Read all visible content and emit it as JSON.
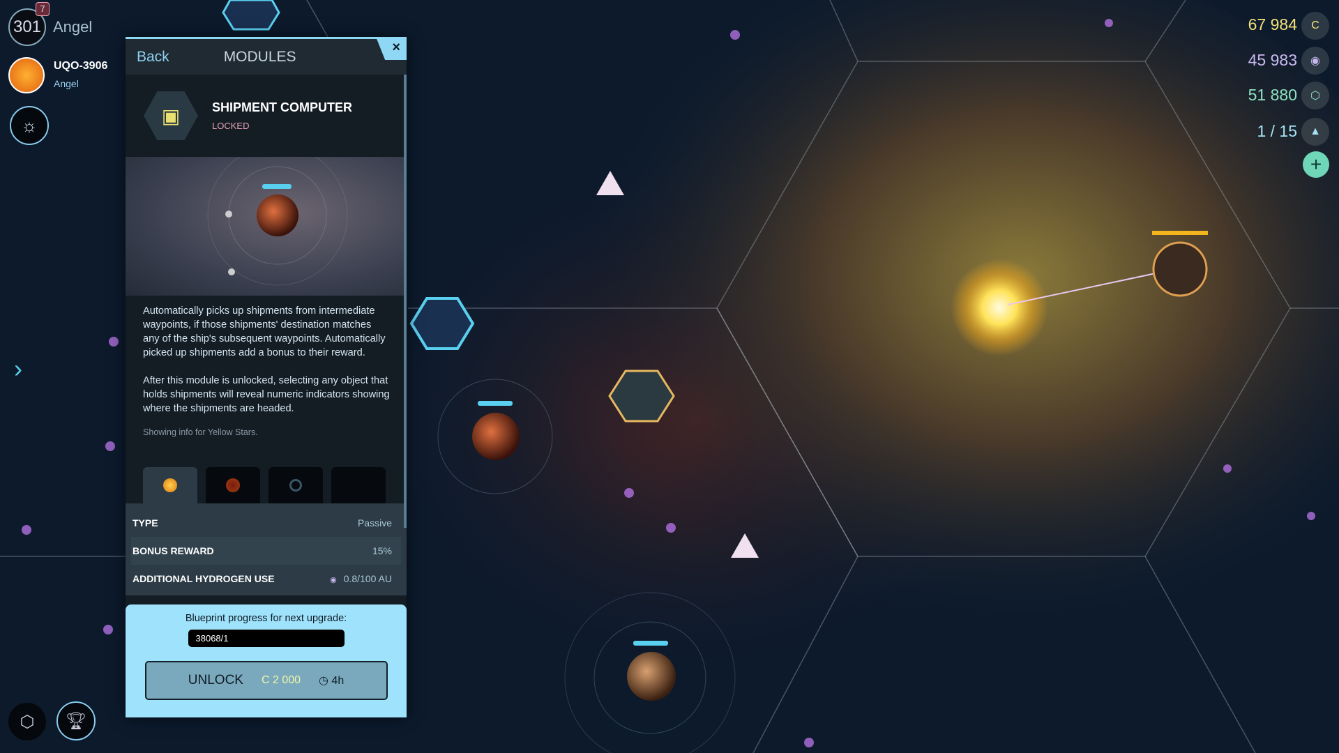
{
  "player": {
    "level": "301",
    "name": "Angel",
    "notifications": "7"
  },
  "system": {
    "name": "UQO-3906",
    "owner": "Angel"
  },
  "resources": [
    {
      "value": "67 984",
      "icon": "credits-icon",
      "color": "#f3e27a"
    },
    {
      "value": "45 983",
      "icon": "hydrogen-icon",
      "color": "#c9b8f0"
    },
    {
      "value": "51 880",
      "icon": "hexagon-icon",
      "color": "#8fe3c4"
    },
    {
      "value": "1 / 15",
      "icon": "ship-icon",
      "color": "#a6e2f4"
    }
  ],
  "panel": {
    "back": "Back",
    "title": "MODULES",
    "close": "×",
    "module_name": "SHIPMENT COMPUTER",
    "module_status": "LOCKED",
    "description": [
      "Automatically picks up shipments from intermediate waypoints, if those shipments' destination matches any of the ship's subsequent waypoints. Automatically picked up shipments add a bonus to their reward.",
      "After this module is unlocked, selecting any object that holds shipments will reveal numeric indicators showing where the shipments are headed."
    ],
    "note": "Showing info for Yellow Stars.",
    "star_tabs": [
      "yellow-star",
      "red-star",
      "blue-star",
      "empty"
    ],
    "stats": [
      {
        "key": "TYPE",
        "value": "Passive"
      },
      {
        "key": "BONUS REWARD",
        "value": "15%"
      },
      {
        "key": "ADDITIONAL HYDROGEN USE",
        "value": "0.8/100 AU"
      }
    ],
    "blueprint_label": "Blueprint progress for next upgrade:",
    "blueprint_value": "38068/1",
    "unlock": {
      "label": "UNLOCK",
      "cost": "2 000",
      "time": "4h"
    }
  },
  "colors": {
    "accent": "#8fd8f5",
    "locked": "#e9a5b8"
  }
}
